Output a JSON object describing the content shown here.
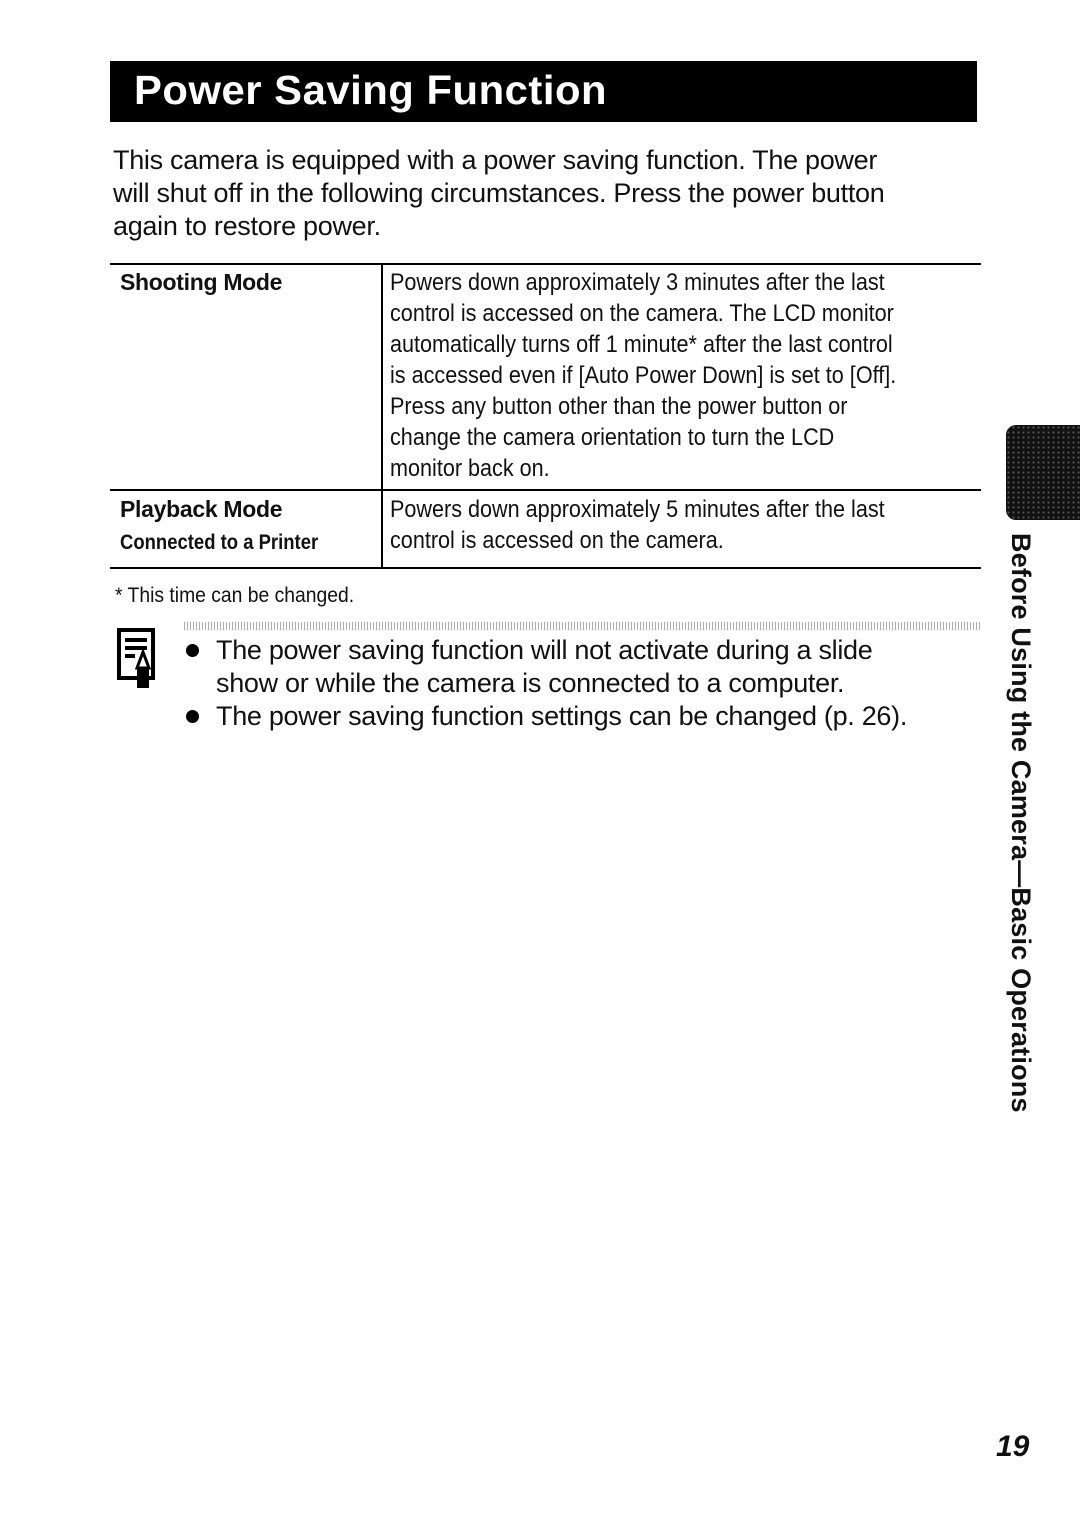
{
  "page": {
    "title": "Power Saving Function",
    "intro_lines": [
      "This camera is equipped with a power saving function. The power",
      "will shut off in the following circumstances. Press the power button",
      "again to restore power."
    ],
    "table": {
      "rows": [
        {
          "label": "Shooting Mode",
          "sublabel": "",
          "description_lines": [
            "Powers down approximately 3 minutes after the last",
            "control is accessed on the camera. The LCD monitor",
            "automatically turns off 1 minute* after the last control",
            "is accessed even if [Auto Power Down] is set to [Off].",
            "Press any button other than the power button or",
            "change the camera orientation to turn the LCD",
            "monitor back on."
          ]
        },
        {
          "label": "Playback Mode",
          "sublabel": "Connected to a Printer",
          "description_lines": [
            "Powers down approximately 5 minutes after the last",
            "control is accessed on the camera."
          ]
        }
      ]
    },
    "footnote": "* This time can be changed.",
    "note_icon": "memo-pencil-icon",
    "notes": [
      {
        "lines": [
          "The power saving function will not activate during a slide",
          "show or while the camera is connected to a computer."
        ]
      },
      {
        "lines": [
          "The power saving function settings can be changed (p. 26)."
        ]
      }
    ],
    "side_tab_text": "Before Using the Camera—Basic Operations",
    "page_number": "19"
  }
}
